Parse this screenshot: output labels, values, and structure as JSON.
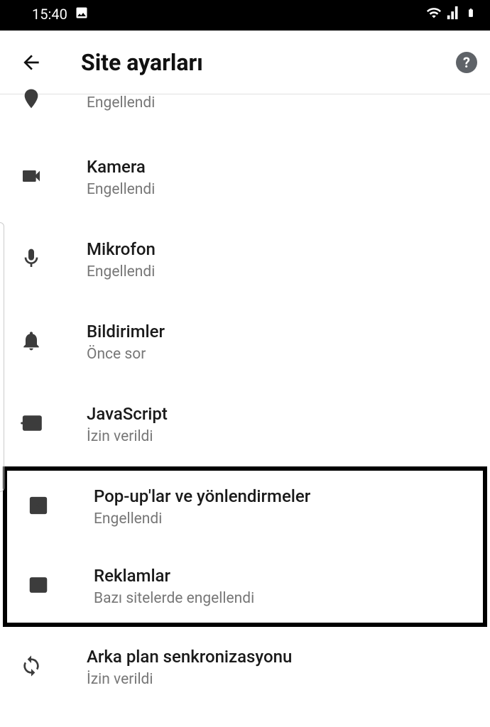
{
  "status": {
    "time": "15:40"
  },
  "header": {
    "title": "Site ayarları"
  },
  "rows": {
    "partial": {
      "subtitle": "Engellendi"
    },
    "camera": {
      "title": "Kamera",
      "subtitle": "Engellendi"
    },
    "mic": {
      "title": "Mikrofon",
      "subtitle": "Engellendi"
    },
    "notif": {
      "title": "Bildirimler",
      "subtitle": "Önce sor"
    },
    "js": {
      "title": "JavaScript",
      "subtitle": "İzin verildi"
    },
    "popups": {
      "title": "Pop-up'lar ve yönlendirmeler",
      "subtitle": "Engellendi"
    },
    "ads": {
      "title": "Reklamlar",
      "subtitle": "Bazı sitelerde engellendi"
    },
    "bgsync": {
      "title": "Arka plan senkronizasyonu",
      "subtitle": "İzin verildi"
    }
  }
}
